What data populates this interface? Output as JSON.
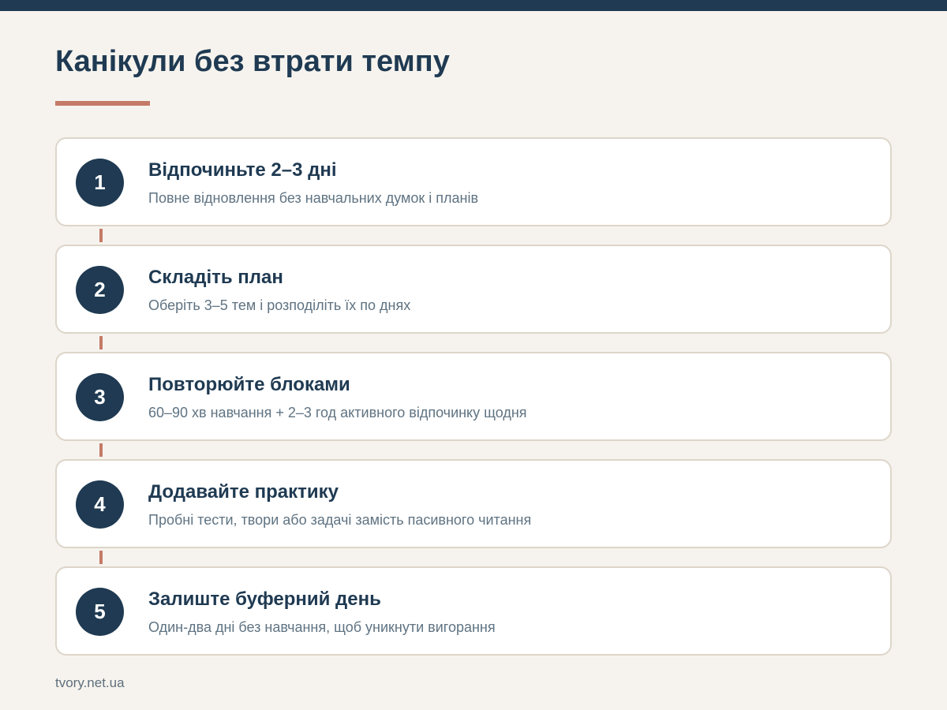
{
  "header": {
    "title": "Канікули без втрати темпу"
  },
  "steps": [
    {
      "number": "1",
      "title": "Відпочиньте 2–3 дні",
      "description": "Повне відновлення без навчальних думок і планів"
    },
    {
      "number": "2",
      "title": "Складіть план",
      "description": "Оберіть 3–5 тем і розподіліть їх по днях"
    },
    {
      "number": "3",
      "title": "Повторюйте блоками",
      "description": "60–90 хв навчання + 2–3 год активного відпочинку щодня"
    },
    {
      "number": "4",
      "title": "Додавайте практику",
      "description": "Пробні тести, твори або задачі замість пасивного читання"
    },
    {
      "number": "5",
      "title": "Залиште буферний день",
      "description": "Один-два дні без навчання, щоб уникнути вигорання"
    }
  ],
  "footer": {
    "source": "tvory.net.ua"
  },
  "colors": {
    "background": "#f6f3ee",
    "primary": "#1f3a52",
    "accent": "#c47a67",
    "card_border": "#ddd5c9",
    "muted_text": "#5f7382"
  }
}
